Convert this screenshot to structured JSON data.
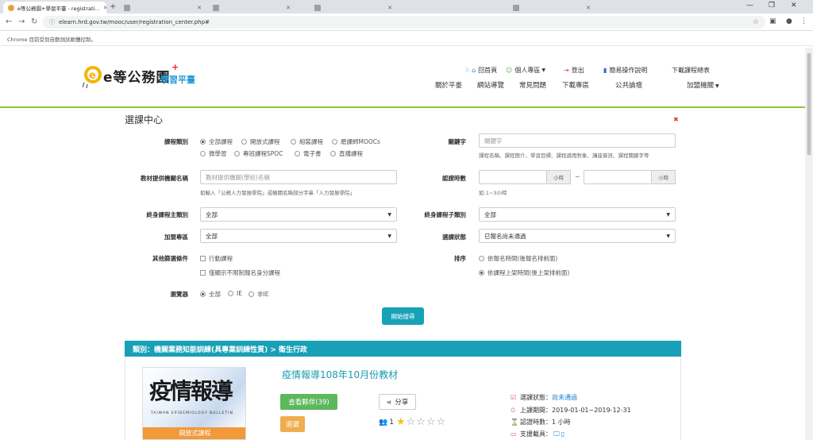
{
  "browser": {
    "tabs": [
      {
        "title": "e等公務園+學習平臺 - registrati…",
        "active": true
      },
      {
        "title": "",
        "active": false
      },
      {
        "title": "",
        "active": false
      },
      {
        "title": "",
        "active": false
      },
      {
        "title": "",
        "active": false
      }
    ],
    "url": "elearn.hrd.gov.tw/mooc/user/registration_center.php#",
    "infobar": "Chrome 目前受到自動測試軟體控制。"
  },
  "header": {
    "logo_main": "e等公務園",
    "logo_plus": "+",
    "logo_sub": "學習平臺",
    "util": {
      "home": "回首頁",
      "personal": "個人專區",
      "logout": "登出",
      "guide": "簡易操作說明",
      "download": "下載課程總表"
    },
    "nav": [
      "關於平臺",
      "網站導覽",
      "常見問題",
      "下載專區",
      "公共論壇",
      "加盟機關"
    ]
  },
  "search": {
    "title": "選課中心",
    "course_type": {
      "label": "課程類別",
      "options": [
        "全部課程",
        "開放式課程",
        "組裝課程",
        "磨課師MOOCs",
        "微學習",
        "專班課程SPOC",
        "電子書",
        "直播課程"
      ]
    },
    "keyword": {
      "label": "關鍵字",
      "placeholder": "關鍵字",
      "hint": "課程名稱、課程簡介、學習目標、課程適用對象、講座資訊、課程關鍵字等"
    },
    "provider": {
      "label": "教材提供機關名稱",
      "placeholder": "教材提供機關(學校)名稱",
      "hint": "如輸入「公務人力發展學院」或機關名稱部分字串「人力發展學院」"
    },
    "hours": {
      "label": "認證時數",
      "unit": "小時",
      "sep": "~",
      "hint": "如:1~3小時"
    },
    "main_cat": {
      "label": "終身課程主類別",
      "value": "全部"
    },
    "sub_cat": {
      "label": "終身課程子類別",
      "value": "全部"
    },
    "alliance": {
      "label": "加盟專區",
      "value": "全部"
    },
    "status": {
      "label": "選課狀態",
      "value": "已報名尚未通過"
    },
    "other": {
      "label": "其他篩選條件",
      "options": [
        "行動課程",
        "僅顯示不限制報名身分課程"
      ]
    },
    "sort": {
      "label": "排序",
      "options": [
        "依報名時間(後報名排前面)",
        "依課程上架時間(後上架排前面)"
      ]
    },
    "browser_filter": {
      "label": "瀏覽器",
      "options": [
        "全部",
        "IE",
        "非IE"
      ]
    },
    "submit": "開始搜尋"
  },
  "results": {
    "category": "類別：機關業務知能訓練(具專業訓練性質) > 衛生行政",
    "course": {
      "title": "疫情報導108年10月份教材",
      "thumb_text": "疫情報導",
      "thumb_sub": "TAIWAN EPIDEMIOLOGY BULLETIN",
      "thumb_ribbon": "開放式課程",
      "btn_peers": "查看夥伴(39)",
      "btn_drop": "退選",
      "btn_share": "分享",
      "people_count": "1",
      "rating": 1,
      "status_label": "選課狀態：",
      "status_value": "尚未通過",
      "period_label": "上課期間：",
      "period_value": "2019-01-01~2019-12-31",
      "hours_label": "認證時數：",
      "hours_value": "1 小時",
      "device_label": "支援載具："
    }
  }
}
